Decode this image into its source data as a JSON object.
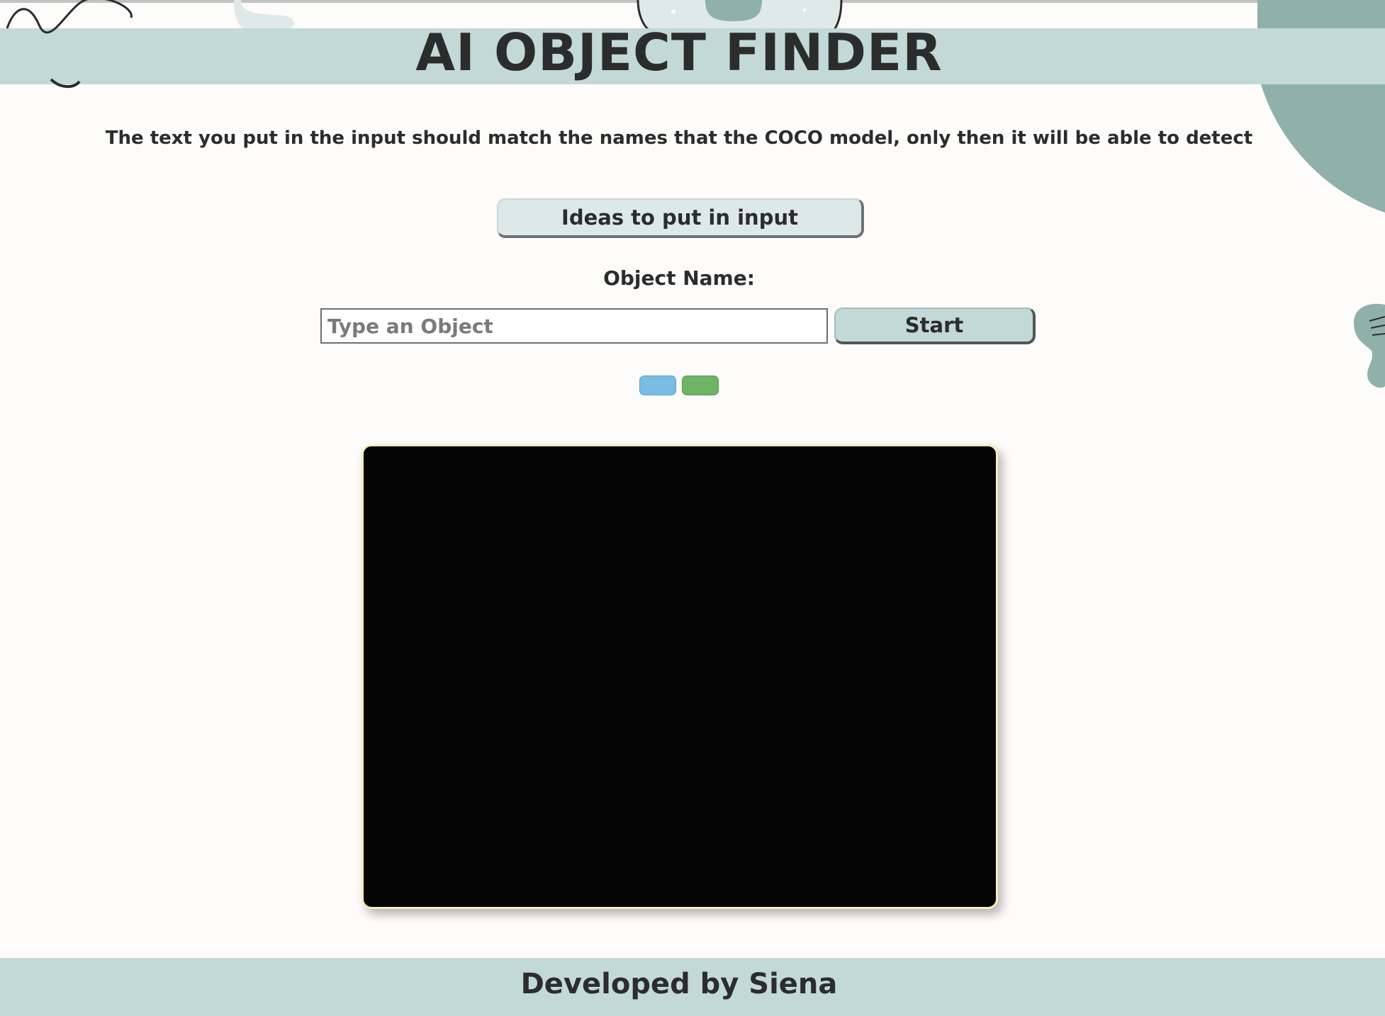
{
  "header": {
    "title": "AI OBJECT FINDER"
  },
  "main": {
    "instruction": "The text you put in the input should match the names that the COCO model, only then it will be able to detect",
    "ideas_button_label": "Ideas to put in input",
    "object_label": "Object Name:",
    "object_input": {
      "value": "",
      "placeholder": "Type an Object"
    },
    "start_button_label": "Start",
    "swatches": [
      {
        "name": "blue",
        "color": "#7abde3"
      },
      {
        "name": "green",
        "color": "#6fb464"
      }
    ]
  },
  "footer": {
    "text": "Developed by Siena"
  },
  "colors": {
    "band": "#c3d9d7",
    "background": "#fdfcfa",
    "deco_teal": "#8fb1aa",
    "video_border": "#f5efb8",
    "video_fill": "#040504"
  }
}
